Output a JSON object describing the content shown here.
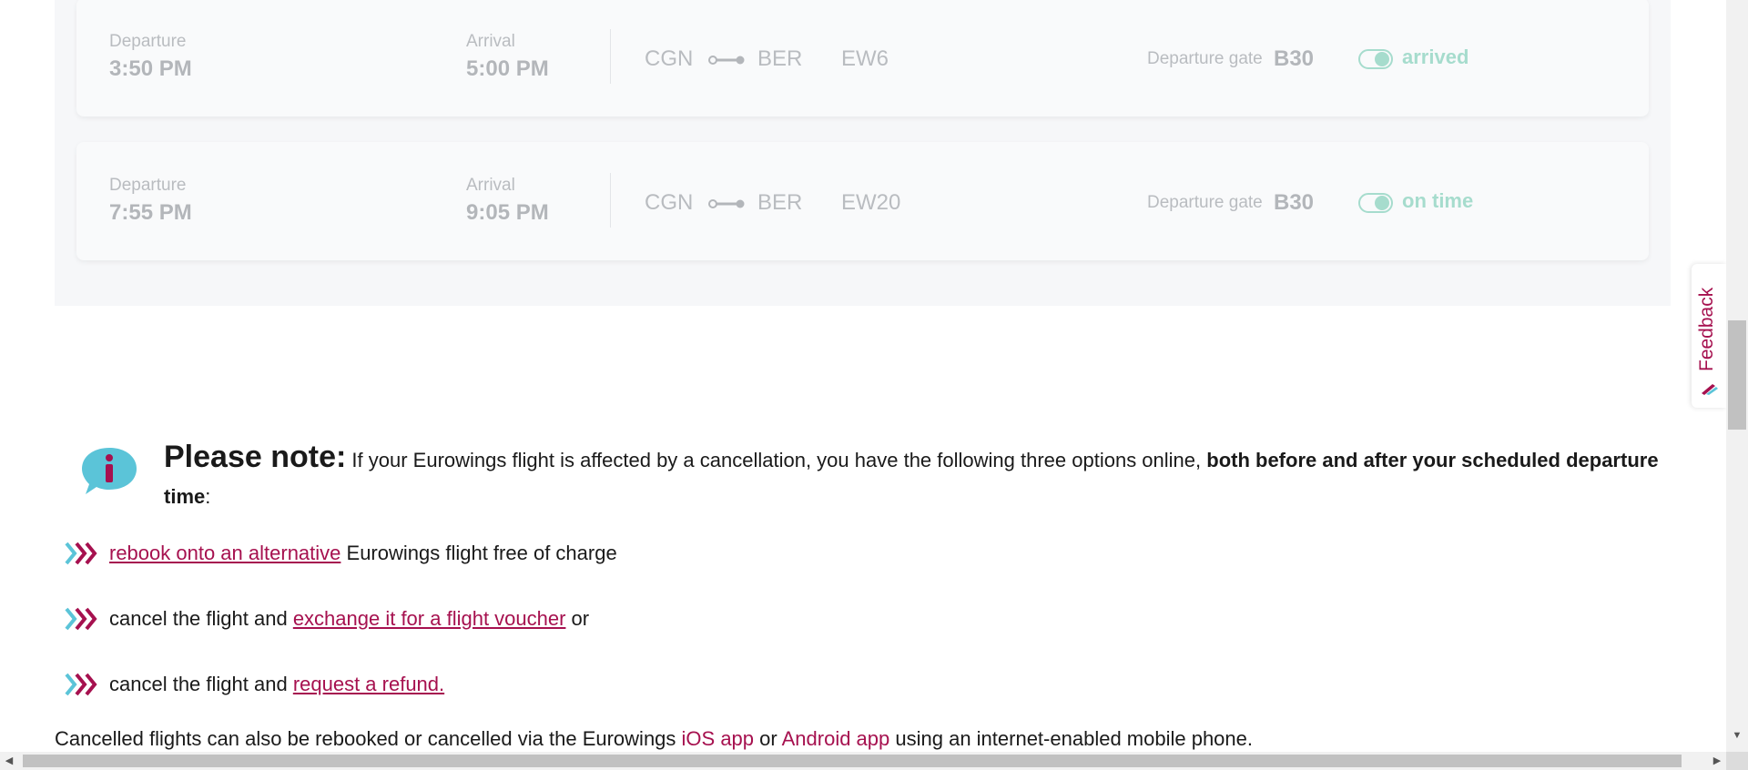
{
  "flights": [
    {
      "departure_label": "Departure",
      "departure_time": "3:50 PM",
      "arrival_label": "Arrival",
      "arrival_time": "5:00 PM",
      "origin": "CGN",
      "destination": "BER",
      "flight_number": "EW6",
      "gate_label": "Departure gate",
      "gate": "B30",
      "status": "arrived"
    },
    {
      "departure_label": "Departure",
      "departure_time": "7:55 PM",
      "arrival_label": "Arrival",
      "arrival_time": "9:05 PM",
      "origin": "CGN",
      "destination": "BER",
      "flight_number": "EW20",
      "gate_label": "Departure gate",
      "gate": "B30",
      "status": "on time"
    }
  ],
  "note": {
    "heading": "Please note:",
    "text": " If your Eurowings flight is affected by a cancellation, you have the following three options online, ",
    "bold_text": "both before and after your scheduled departure time",
    "after_bold": ":"
  },
  "options": [
    {
      "link": "rebook onto an alternative",
      "after": " Eurowings flight free of charge"
    },
    {
      "before": "cancel the flight and ",
      "link": "exchange it for a flight voucher",
      "after": " or"
    },
    {
      "before": "cancel the flight and ",
      "link": "request a refund."
    }
  ],
  "bottom_line": {
    "before": "Cancelled flights can also be rebooked or cancelled via the Eurowings ",
    "ios_link": "iOS app",
    "middle": " or ",
    "android_link": "Android app",
    "after": " using an internet-enabled mobile phone."
  },
  "feedback": {
    "label": "Feedback"
  },
  "colors": {
    "brand_primary": "#a6114f",
    "status_green": "#a6dccd",
    "info_icon_bg": "#5bc4d8"
  },
  "icons": {
    "info": "info-speech-bubble-icon",
    "chevrons": "triple-chevron-right-icon",
    "route": "route-connector-icon",
    "status_toggle": "status-toggle-icon",
    "feedback_logo": "eurowings-logo-icon"
  }
}
